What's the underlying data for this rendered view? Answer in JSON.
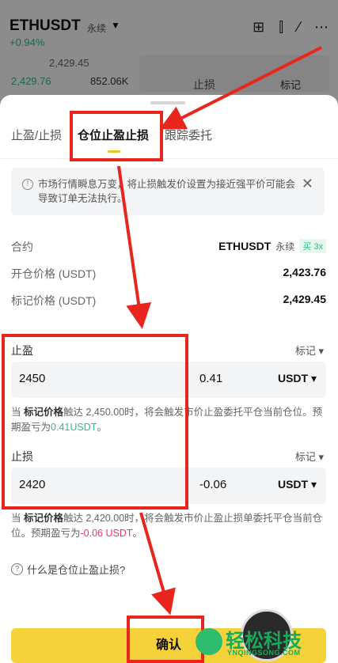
{
  "background": {
    "pair": "ETHUSDT",
    "perp": "永续",
    "change": "+0.94%",
    "mid_price": "2,429.45",
    "orderbook_price": "2,429.76",
    "orderbook_qty": "852.06K",
    "order_type_label": "止损",
    "order_mark_label": "标记"
  },
  "tabs": [
    {
      "label": "止盈/止损"
    },
    {
      "label": "仓位止盈止损"
    },
    {
      "label": "跟踪委托"
    }
  ],
  "active_tab": 1,
  "warning": {
    "text": "市场行情瞬息万变，将止损触发价设置为接近强平价可能会导致订单无法执行。"
  },
  "contract": {
    "label": "合约",
    "symbol": "ETHUSDT",
    "perp": "永续",
    "side_leverage": "买 3x"
  },
  "open_price": {
    "label": "开仓价格 (USDT)",
    "value": "2,423.76"
  },
  "mark_price": {
    "label": "标记价格 (USDT)",
    "value": "2,429.45"
  },
  "take_profit": {
    "label": "止盈",
    "mark_label": "标记",
    "price": "2450",
    "pnl": "0.41",
    "unit": "USDT",
    "hint_prefix": "当",
    "hint_mark": "标记价格",
    "hint_mid": "触达 2,450.00时，将会触发市价止盈委托平仓当前仓位。预期盈亏为",
    "hint_value": "0.41USDT",
    "hint_end": "。"
  },
  "stop_loss": {
    "label": "止损",
    "mark_label": "标记",
    "price": "2420",
    "pnl": "-0.06",
    "unit": "USDT",
    "hint_prefix": "当",
    "hint_mark": "标记价格",
    "hint_mid": "触达 2,420.00时，将会触发市价止盈止损单委托平仓当前仓位。预期盈亏为",
    "hint_value": "-0.06 USDT",
    "hint_end": "。"
  },
  "faq": "什么是仓位止盈止损?",
  "confirm_label": "确认",
  "watermark": {
    "name": "轻松科技",
    "url": "YNQINGSONG.COM"
  },
  "colors": {
    "accent": "#f5d23a",
    "profit": "#2ebd85",
    "loss": "#e53965",
    "annotation": "#e8261d"
  }
}
